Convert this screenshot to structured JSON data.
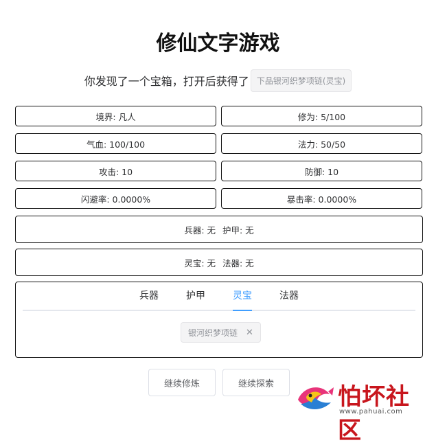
{
  "title": "修仙文字游戏",
  "message": {
    "text": "你发现了一个宝箱，打开后获得了",
    "loot": "下品银河织梦项链(灵宝)"
  },
  "stats": {
    "realm": "境界: 凡人",
    "cultivation": "修为: 5/100",
    "hp": "气血: 100/100",
    "mana": "法力: 50/50",
    "attack": "攻击: 10",
    "defense": "防御: 10",
    "dodge": "闪避率: 0.0000%",
    "crit": "暴击率: 0.0000%"
  },
  "equipment": {
    "weapon": "兵器: 无",
    "armor": "护甲: 无",
    "treasure": "灵宝: 无",
    "artifact": "法器: 无"
  },
  "tabs": [
    {
      "label": "兵器"
    },
    {
      "label": "护甲"
    },
    {
      "label": "灵宝"
    },
    {
      "label": "法器"
    }
  ],
  "active_tab": "灵宝",
  "inventory_item": "银河织梦项链",
  "buttons": {
    "continue_cultivate": "继续修炼",
    "continue_explore": "继续探索"
  },
  "watermark": {
    "text": "怕坏社区",
    "url": "www.pahuai.com"
  },
  "colors": {
    "accent": "#409eff",
    "border": "#111111",
    "tag_bg": "#f4f4f5"
  }
}
